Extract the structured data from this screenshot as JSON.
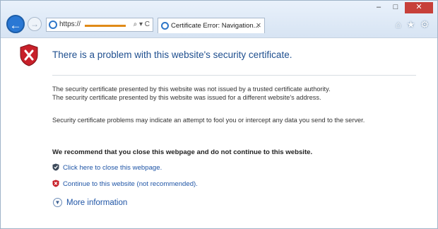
{
  "browser": {
    "address_prefix": "https://",
    "address_tools": "⌕ ▾ C",
    "tab_title": "Certificate Error: Navigation...",
    "tab_close": "✕",
    "minimize": "–",
    "maximize": "□",
    "close": "✕",
    "icons": [
      "home-icon",
      "star-icon",
      "gear-icon"
    ]
  },
  "page": {
    "title": "There is a problem with this website's security certificate.",
    "para1_line1": "The security certificate presented by this website was not issued by a trusted certificate authority.",
    "para1_line2": "The security certificate presented by this website was issued for a different website's address.",
    "para2": "Security certificate problems may indicate an attempt to fool you or intercept any data you send to the server.",
    "recommendation": "We recommend that you close this webpage and do not continue to this website.",
    "close_link": "Click here to close this webpage.",
    "continue_link": "Continue to this website (not recommended).",
    "more_info": "More information"
  }
}
